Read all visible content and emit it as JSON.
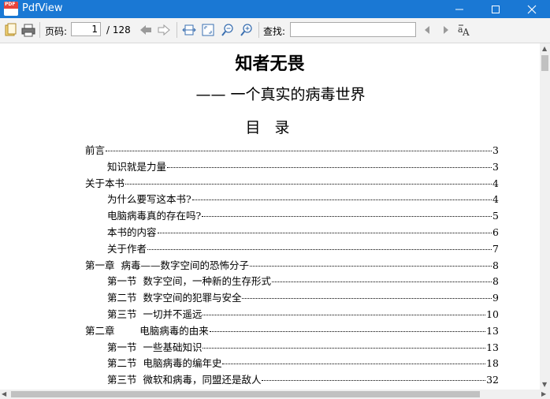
{
  "window": {
    "title": "PdfView"
  },
  "toolbar": {
    "page_label": "页码:",
    "page_value": "1",
    "page_total": "/ 128",
    "search_label": "查找:",
    "search_value": ""
  },
  "document": {
    "title": "知者无畏",
    "subtitle": "—— 一个真实的病毒世界",
    "toc_heading": "目 录",
    "toc": [
      {
        "text": "前言",
        "page": "3",
        "level": 0
      },
      {
        "text": "知识就是力量",
        "page": "3",
        "level": 1
      },
      {
        "text": "关于本书",
        "page": "4",
        "level": 0
      },
      {
        "text": "为什么要写这本书?",
        "page": "4",
        "level": 1
      },
      {
        "text": "电脑病毒真的存在吗?",
        "page": "5",
        "level": 1
      },
      {
        "text": "本书的内容",
        "page": "6",
        "level": 1
      },
      {
        "text": "关于作者",
        "page": "7",
        "level": 1
      },
      {
        "text": "第一章  病毒——数字空间的恐怖分子",
        "page": "8",
        "level": 0
      },
      {
        "text": "第一节  数字空间，一种新的生存形式",
        "page": "8",
        "level": 1
      },
      {
        "text": "第二节  数字空间的犯罪与安全",
        "page": "9",
        "level": 1
      },
      {
        "text": "第三节  一切并不遥远",
        "page": "10",
        "level": 1
      },
      {
        "text": "第二章        电脑病毒的由来",
        "page": "13",
        "level": 0
      },
      {
        "text": "第一节  一些基础知识",
        "page": "13",
        "level": 1
      },
      {
        "text": "第二节  电脑病毒的编年史",
        "page": "18",
        "level": 1
      },
      {
        "text": "第三节  微软和病毒，同盟还是敌人",
        "page": "32",
        "level": 1
      }
    ]
  },
  "colors": {
    "titlebar": "#1a78d4",
    "app_icon": "#e8443a"
  }
}
